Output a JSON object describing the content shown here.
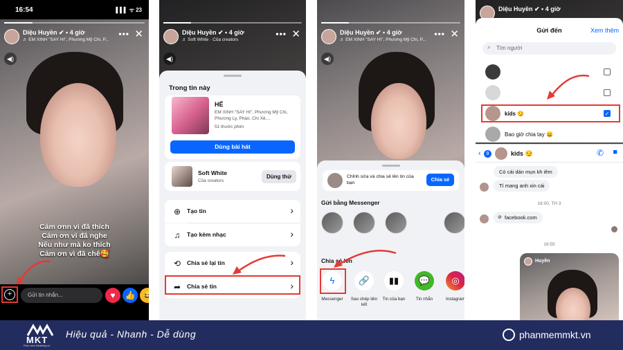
{
  "colors": {
    "accent": "#0866ff",
    "highlight": "#e53935",
    "footer_bg": "#232c5e"
  },
  "p1": {
    "status_time": "16:54",
    "status_right": "▌▌▌ ᯤ 23",
    "story_name": "Diệu Huyền ✔ • 4 giờ",
    "story_sub": "♬ EM XINH \"SAY HI\", Phương Mỹ Chi, P...",
    "caption": [
      "Cảm ơnn vì đã thích",
      "Cảm ơn vì đã nghe",
      "Nếu như mà ko thích",
      "Cảm ơn vì đã chê🥰"
    ],
    "message_placeholder": "Gửi tin nhắn..."
  },
  "p2": {
    "story_name": "Diệu Huyền ✔ • 4 giờ",
    "story_sub": "♬ Soft White · Của creators",
    "section_title": "Trong tin này",
    "song_title": "HẾ",
    "song_sub": "EM XINH \"SAY HI\", Phương Mỹ Chi, Phương Ly, Pháo, Chi Xê,...",
    "song_meta": "51 thước phim",
    "use_song": "Dùng bài hát",
    "effect_name": "Soft White",
    "effect_sub": "Của creators",
    "try_label": "Dùng thử",
    "menu": [
      "Tạo tin",
      "Tạo kèm nhạc",
      "Chia sẻ lại tin",
      "Chia sẻ tin"
    ]
  },
  "p3": {
    "story_name": "Diệu Huyền ✔ • 4 giờ",
    "story_sub": "♬ EM XINH \"SAY HI\", Phương Mỹ Chi, P...",
    "edit_text": "Chỉnh sửa và chia sẻ lên tin của bạn",
    "share_button": "Chia sẻ",
    "messenger_title": "Gửi bằng Messenger",
    "share_to_title": "Chia sẻ lên",
    "share_items": [
      "Messenger",
      "Sao chép liên kết",
      "Tin của bạn",
      "Tin nhắn",
      "Instagram"
    ]
  },
  "p4": {
    "story_name": "Diệu Huyền ✔ • 4 giờ",
    "title": "Gửi đến",
    "more": "Xem thêm",
    "search_placeholder": "Tìm người",
    "contacts": [
      "",
      "",
      "kids 😏",
      "Bao giờ chia tay 😄"
    ],
    "chat_name": "kids 😏",
    "back_count": "9",
    "messages": [
      "Có cái dán mụn kh iêm",
      "Tí mang anh xin cái"
    ],
    "time1": "16:00, TH 3",
    "link": "facebook.com",
    "time2": "16:55",
    "shared_name": "Huyền"
  },
  "footer": {
    "logo": "MKT",
    "logo_sub": "Phần mềm Marketing số",
    "slogan": "Hiệu quả - Nhanh - Dễ dùng",
    "site": "phanmemmkt.vn"
  }
}
